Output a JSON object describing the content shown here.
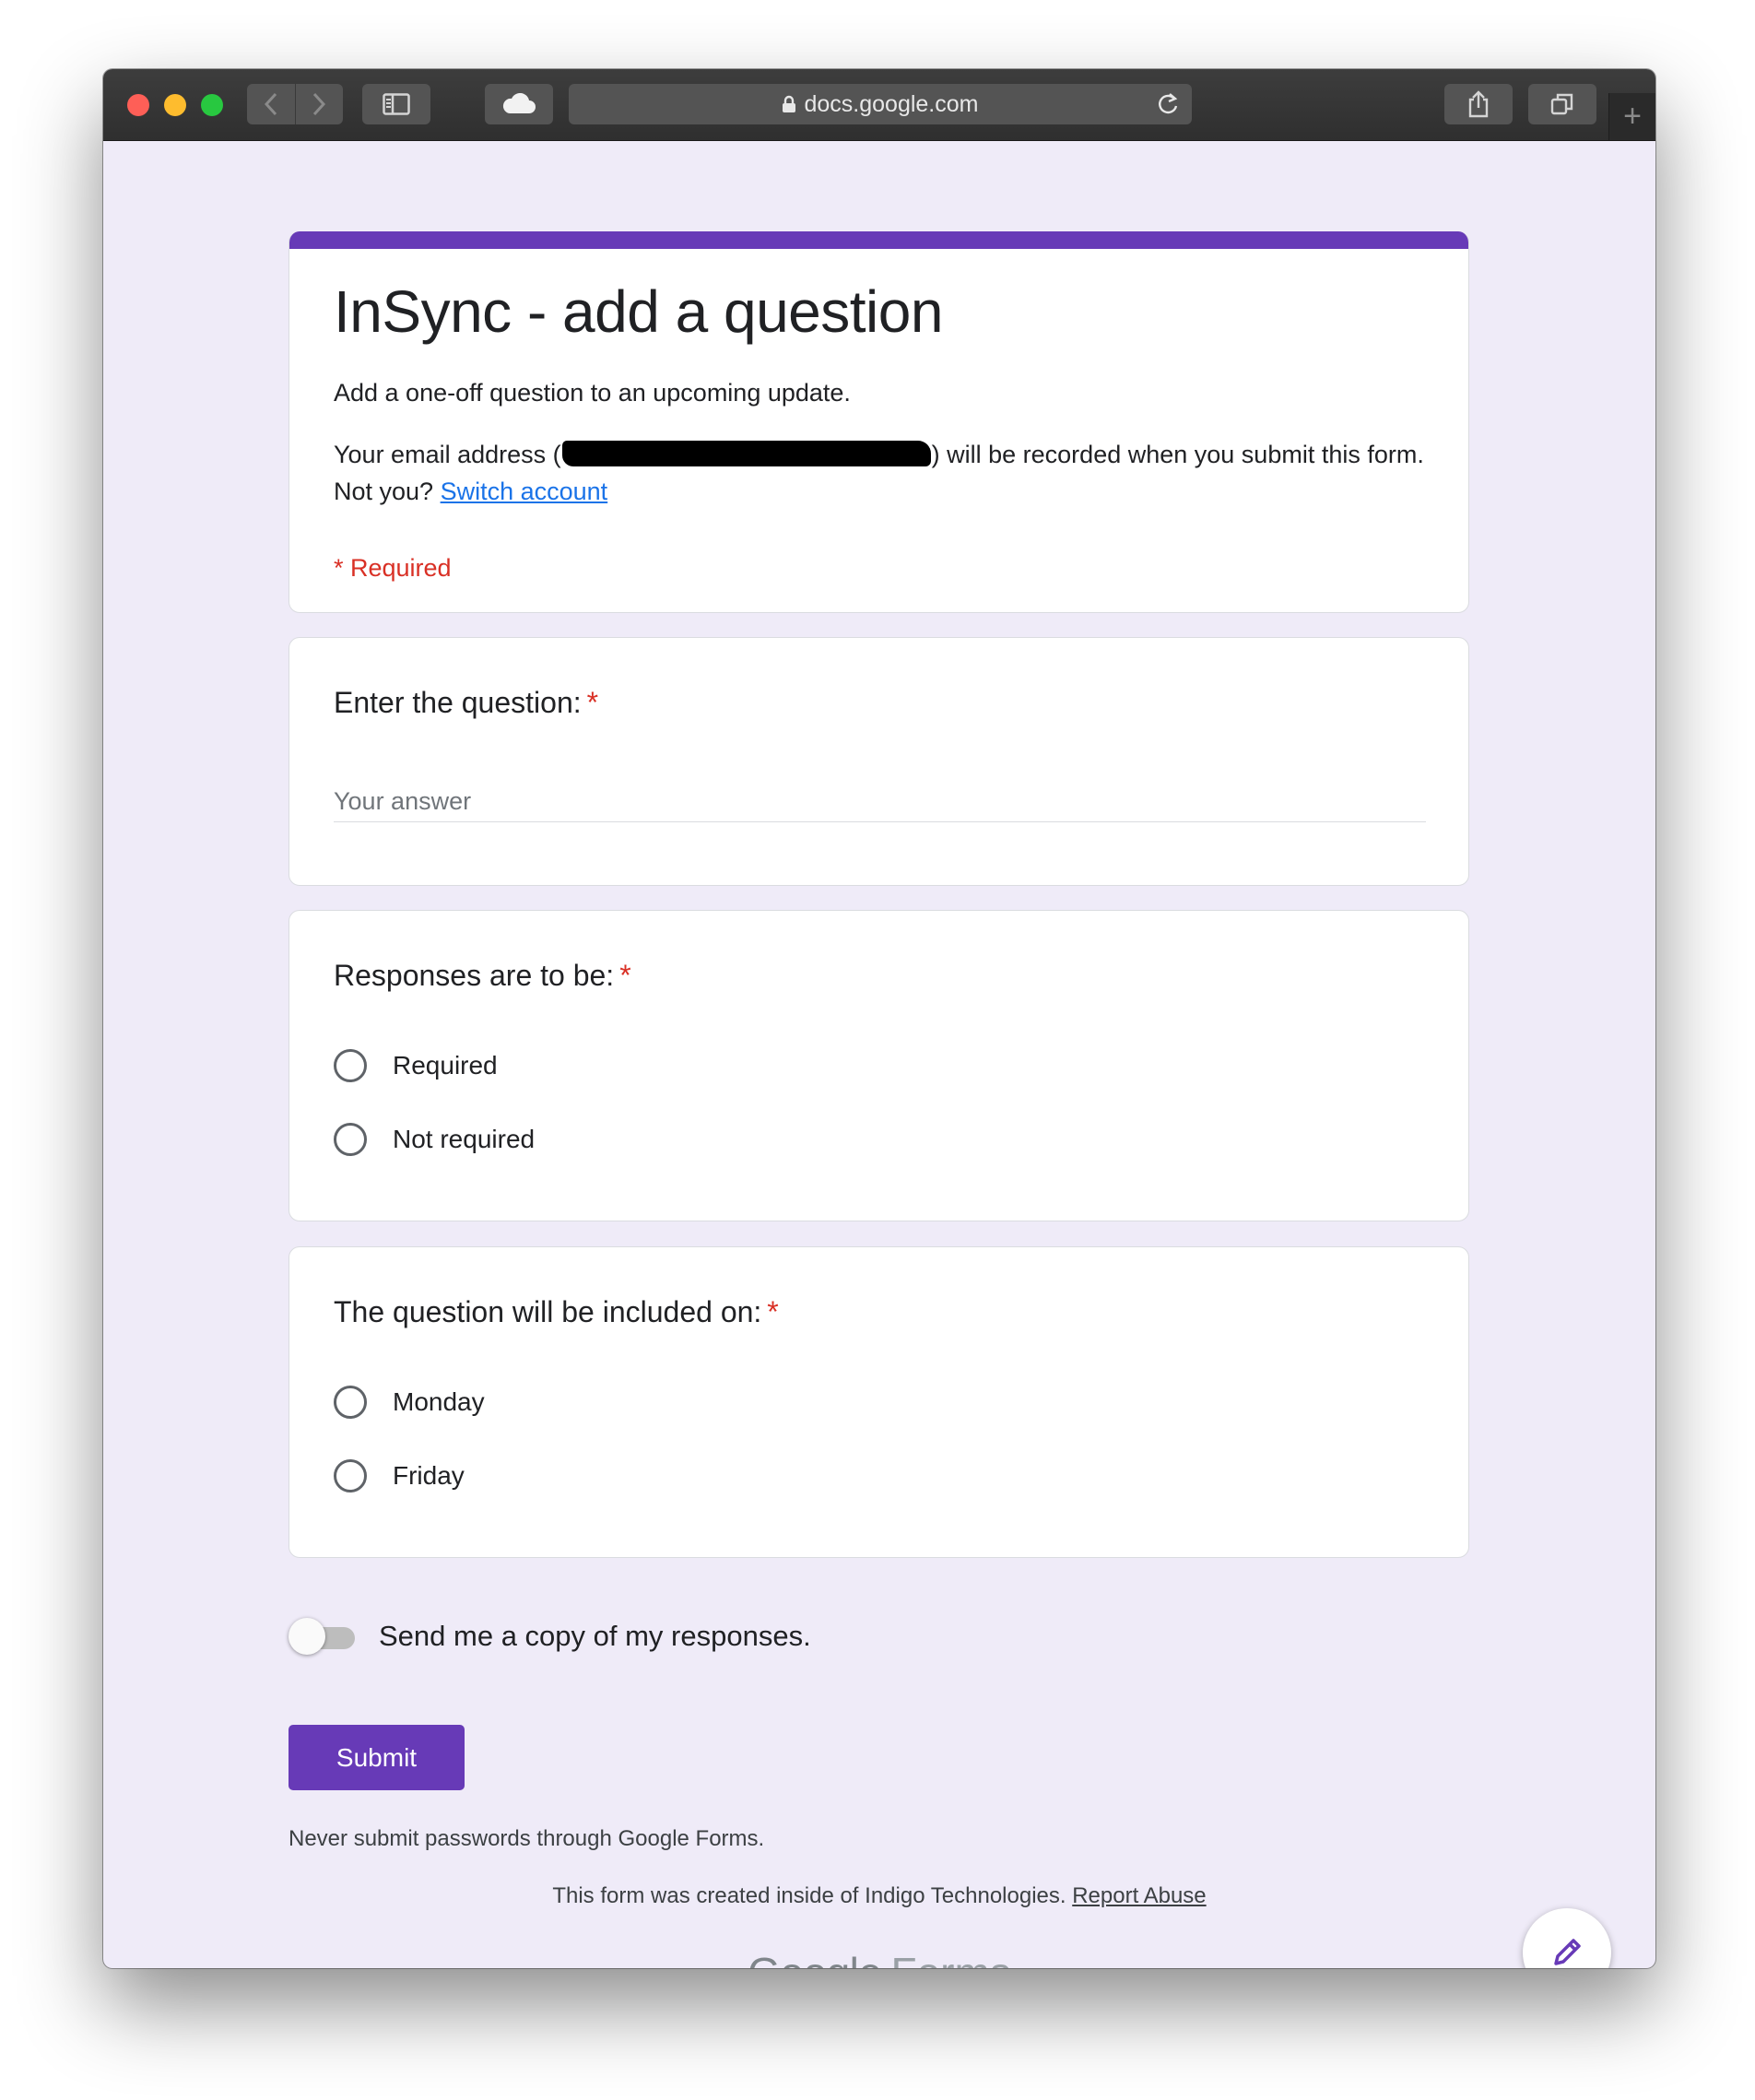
{
  "browser": {
    "url": "docs.google.com"
  },
  "form": {
    "title": "InSync - add a question",
    "description": "Add a one-off question to an upcoming update.",
    "email_note_prefix": "Your email address (",
    "email_note_suffix": ") will be recorded when you submit this form. Not you?",
    "switch_account": "Switch account",
    "required_note": "* Required"
  },
  "questions": [
    {
      "title": "Enter the question:",
      "required_star": "*",
      "placeholder": "Your answer"
    },
    {
      "title": "Responses are to be:",
      "required_star": "*",
      "options": [
        "Required",
        "Not required"
      ]
    },
    {
      "title": "The question will be included on:",
      "required_star": "*",
      "options": [
        "Monday",
        "Friday"
      ]
    }
  ],
  "copy_toggle": {
    "label": "Send me a copy of my responses.",
    "checked": false
  },
  "submit_label": "Submit",
  "footer": {
    "password_warning": "Never submit passwords through Google Forms.",
    "created_note": "This form was created inside of Indigo Technologies.",
    "report_abuse": "Report Abuse",
    "logo_google": "Google",
    "logo_forms": "Forms"
  },
  "colors": {
    "accent": "#673ab7",
    "required": "#d93025",
    "link": "#1a73e8",
    "background": "#efebf8"
  }
}
